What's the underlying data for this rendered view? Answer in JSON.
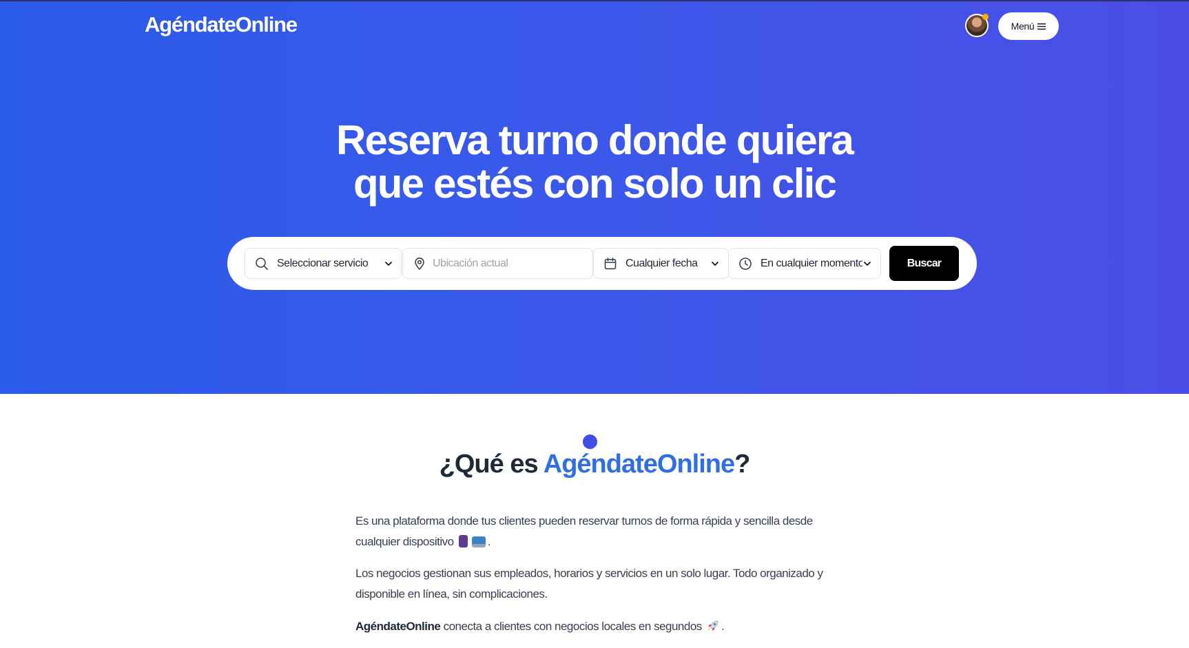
{
  "header": {
    "logo": "AgéndateOnline",
    "menu_label": "Menú",
    "menu_icon": "hamburger-icon",
    "avatar_icon": "user-avatar",
    "status_color": "#f5b301"
  },
  "hero": {
    "headline_line1": "Reserva turno donde quiera",
    "headline_line2": "que estés con solo un clic",
    "gradient_colors": [
      "#2a5be8",
      "#4b4ee6"
    ]
  },
  "search": {
    "service_label": "Seleccionar servicio",
    "location_placeholder": "Ubicación actual",
    "date_label": "Cualquier fecha",
    "time_label": "En cualquier momento",
    "button_label": "Buscar",
    "icons": {
      "service": "search-icon",
      "location": "map-pin-icon",
      "date": "calendar-icon",
      "time": "clock-icon",
      "dropdown": "chevron-down-icon"
    }
  },
  "about": {
    "title_prefix": "¿Qué es ",
    "title_brand": "AgéndateOnline",
    "title_suffix": "?",
    "accent_color": "#2f6fe3",
    "p1": "Es una plataforma donde tus clientes pueden reservar turnos de forma rápida y sencilla desde cualquier dispositivo",
    "p1_end": ".",
    "p2": "Los negocios gestionan sus empleados, horarios y servicios en un solo lugar. Todo organizado y disponible en línea, sin complicaciones.",
    "p3_brand": "AgéndateOnline",
    "p3": " conecta a clientes con negocios locales en segundos",
    "p3_end": "."
  }
}
